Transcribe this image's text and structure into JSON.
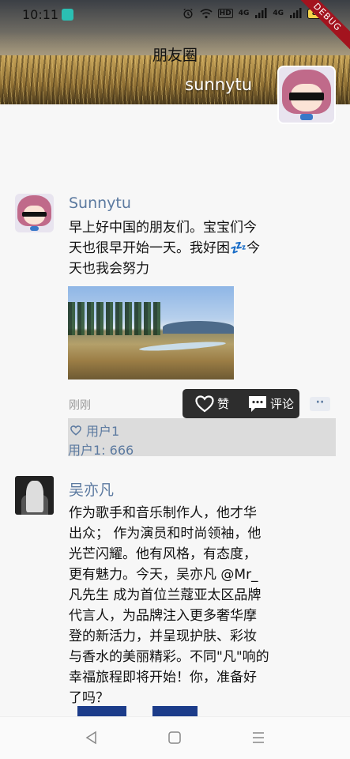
{
  "status_bar": {
    "time": "10:11",
    "hd_label": "HD",
    "signal1_label": "4G",
    "signal2_label": "4G",
    "battery": "82",
    "debug_banner": "DEBUG"
  },
  "app_bar": {
    "title": "朋友圈"
  },
  "cover": {
    "username": "sunnytu"
  },
  "posts": [
    {
      "author": "Sunnytu",
      "content_lines": [
        "早上好中国的朋友们。宝宝们今",
        "天也很早开始一天。我好困💤今",
        "天也我会努力"
      ],
      "time": "刚刚",
      "action_popup": {
        "like_label": "赞",
        "comment_label": "评论"
      },
      "more_label": "··",
      "likes": "用户1",
      "comments": [
        {
          "text": "用户1: 666"
        }
      ]
    },
    {
      "author": "吴亦凡",
      "content_lines": [
        "作为歌手和音乐制作人，他才华",
        "出众；  作为演员和时尚领袖，他",
        "光芒闪耀。他有风格，有态度，",
        "更有魅力。今天，吴亦凡 @Mr_",
        "凡先生 成为首位兰蔻亚太区品牌",
        "代言人，为品牌注入更多奢华摩",
        "登的新活力，并呈现护肤、彩妆",
        "与香水的美丽精彩。不同\"凡\"响的",
        "幸福旅程即将开始！你，准备好",
        "了吗？"
      ]
    }
  ],
  "colors": {
    "author_blue": "#5c7aa0",
    "popup_bg": "#2d2d2d",
    "likes_bg": "#dcdcdc",
    "debug_red": "#a3131e"
  },
  "icons": {
    "like": "heart-outline-icon",
    "comment": "comment-bubble-icon",
    "nav_back": "triangle-back-icon",
    "nav_home": "square-home-icon",
    "nav_menu": "menu-lines-icon"
  }
}
